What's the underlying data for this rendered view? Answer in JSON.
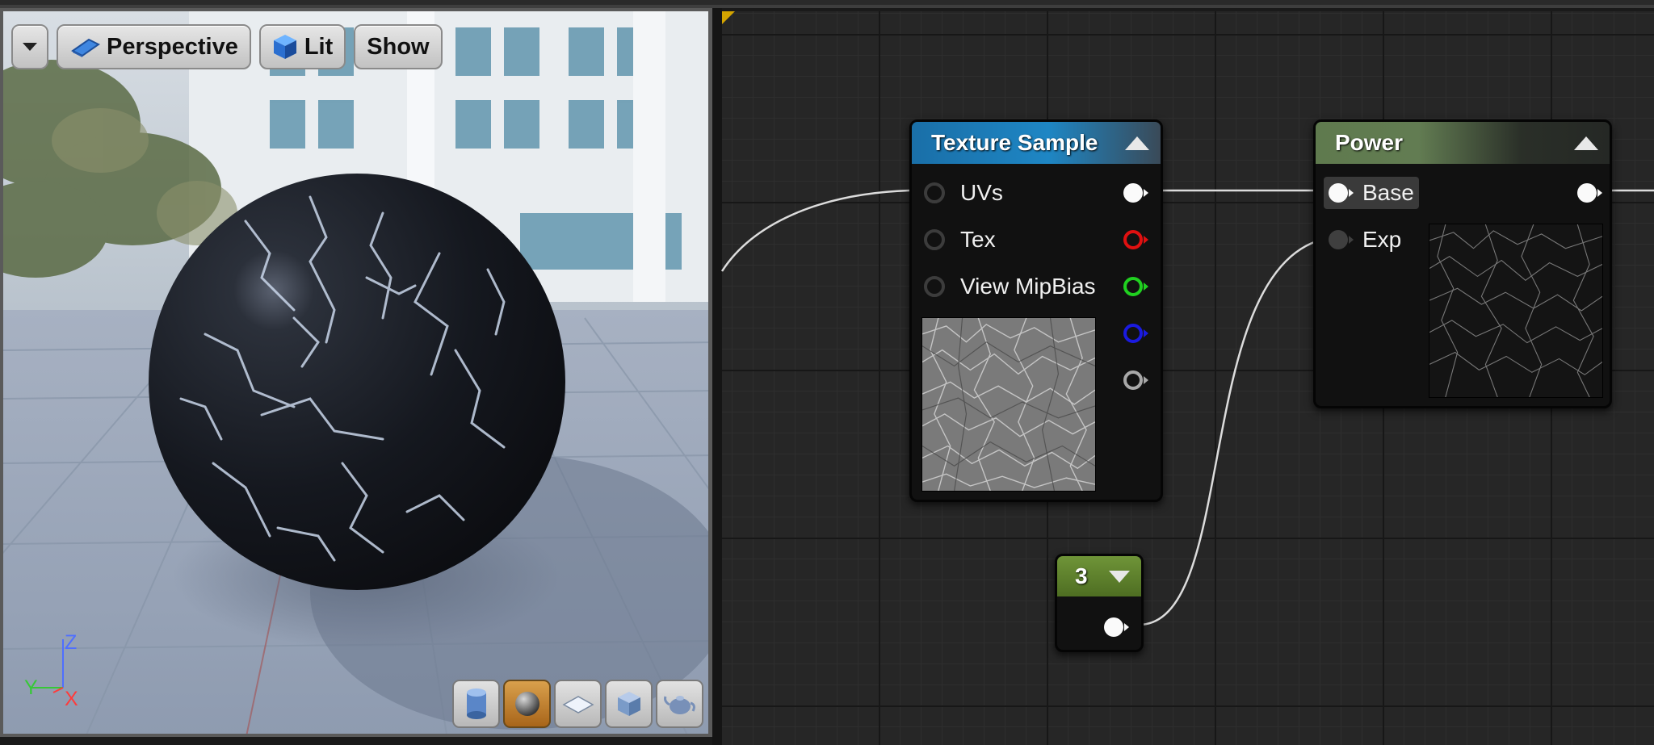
{
  "viewport": {
    "toolbar": {
      "view_mode_label": "Perspective",
      "lighting_label": "Lit",
      "show_label": "Show"
    },
    "axes": {
      "z": "Z",
      "y": "Y",
      "x": "X"
    },
    "preview_shapes": [
      {
        "name": "cylinder",
        "active": false
      },
      {
        "name": "sphere",
        "active": true
      },
      {
        "name": "plane",
        "active": false
      },
      {
        "name": "cube",
        "active": false
      },
      {
        "name": "teapot",
        "active": false
      }
    ]
  },
  "graph": {
    "texture_sample": {
      "title": "Texture Sample",
      "inputs": [
        "UVs",
        "Tex",
        "View MipBias"
      ],
      "outputs": [
        "white",
        "red",
        "green",
        "blue",
        "gray"
      ],
      "header_color": "#1a6fa8"
    },
    "power": {
      "title": "Power",
      "inputs": [
        "Base",
        "Exp"
      ],
      "header_color": "#5f7a4e"
    },
    "constant": {
      "value": "3",
      "header_color": "#5c7c2a"
    }
  }
}
